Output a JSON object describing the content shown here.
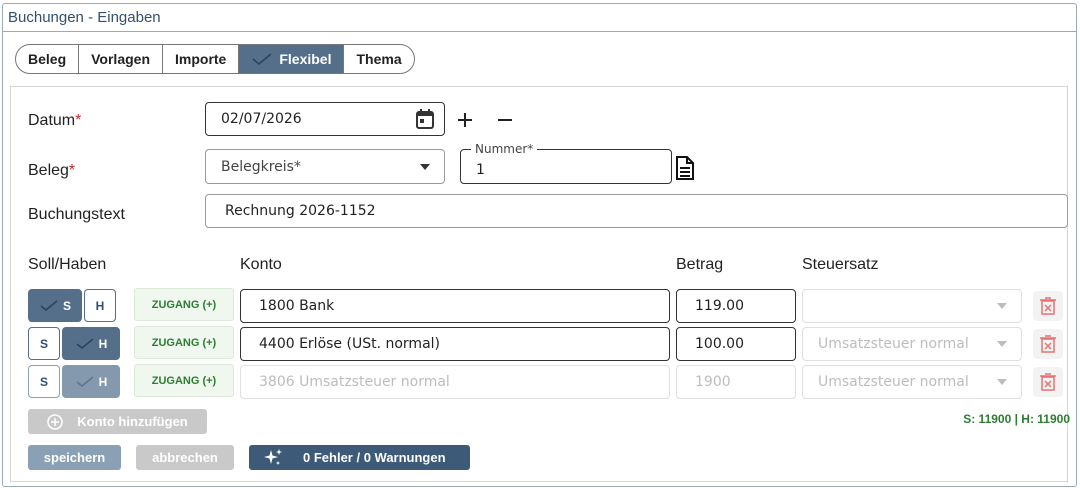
{
  "window": {
    "title": "Buchungen - Eingaben"
  },
  "tabs": [
    {
      "label": "Beleg",
      "active": false
    },
    {
      "label": "Vorlagen",
      "active": false
    },
    {
      "label": "Importe",
      "active": false
    },
    {
      "label": "Flexibel",
      "active": true
    },
    {
      "label": "Thema",
      "active": false
    }
  ],
  "form": {
    "datum_label": "Datum",
    "datum_value": "02/07/2026",
    "beleg_label": "Beleg",
    "belegkreis_placeholder": "Belegkreis*",
    "nummer_label": "Nummer*",
    "nummer_value": "1",
    "buchungstext_label": "Buchungstext",
    "buchungstext_value": "Rechnung 2026-1152",
    "required_mark": "*"
  },
  "columns": {
    "soll_haben": "Soll/Haben",
    "konto": "Konto",
    "betrag": "Betrag",
    "steuersatz": "Steuersatz"
  },
  "rows": [
    {
      "soll": "S",
      "haben": "H",
      "selected": "S",
      "type": "ZUGANG (+)",
      "konto": "1800 Bank",
      "betrag": "119.00",
      "steuersatz": "",
      "disabled": false
    },
    {
      "soll": "S",
      "haben": "H",
      "selected": "H",
      "type": "ZUGANG (+)",
      "konto": "4400 Erlöse (USt. normal)",
      "betrag": "100.00",
      "steuersatz": "Umsatzsteuer normal",
      "disabled": false
    },
    {
      "soll": "S",
      "haben": "H",
      "selected": "H",
      "type": "ZUGANG (+)",
      "konto": "3806 Umsatzsteuer normal",
      "betrag": "1900",
      "steuersatz": "Umsatzsteuer normal",
      "disabled": true
    }
  ],
  "actions": {
    "add_konto": "Konto hinzufügen",
    "save": "speichern",
    "cancel": "abbrechen",
    "validation": "0 Fehler / 0 Warnungen"
  },
  "totals": "S: 11900  |  H: 11900",
  "colors": {
    "accent": "#556e8a",
    "required": "#c62828",
    "success": "#2e7d32",
    "delete": "#e57373"
  }
}
